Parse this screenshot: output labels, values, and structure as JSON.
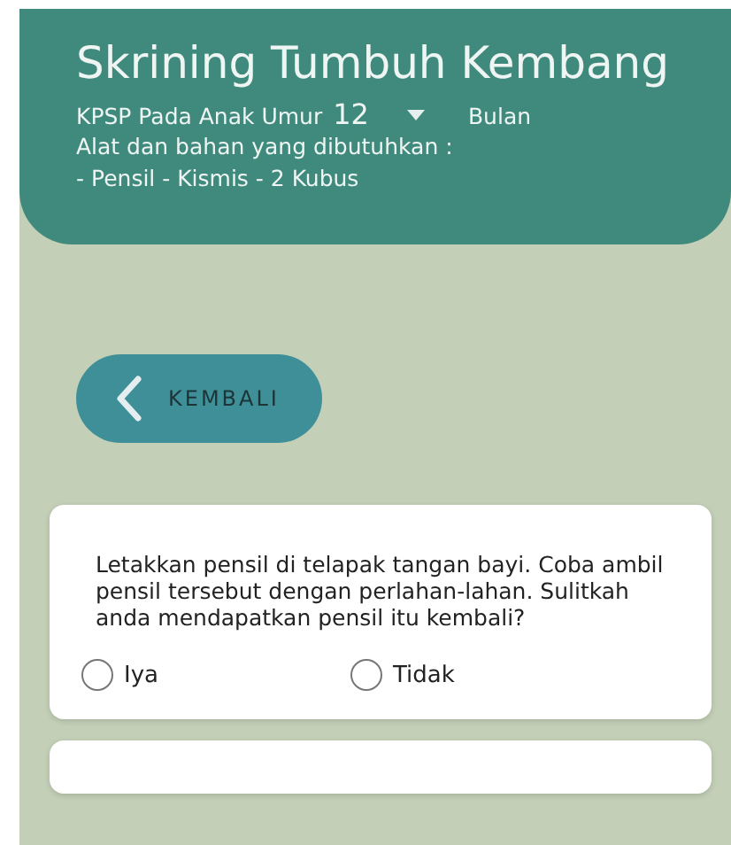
{
  "header": {
    "title": "Skrining Tumbuh Kembang",
    "age_label": "KPSP Pada Anak Umur",
    "age_value": "12",
    "age_unit": "Bulan",
    "tools_label": "Alat dan bahan yang dibutuhkan :",
    "tools": "- Pensil - Kismis - 2 Kubus"
  },
  "back_button": {
    "label": "KEMBALI"
  },
  "questions": [
    {
      "text": "Letakkan pensil di telapak tangan bayi. Coba ambil pensil tersebut dengan perlahan-lahan. Sulitkah anda mendapatkan pensil itu kembali?",
      "options": [
        {
          "label": "Iya",
          "selected": false
        },
        {
          "label": "Tidak",
          "selected": false
        }
      ]
    }
  ]
}
